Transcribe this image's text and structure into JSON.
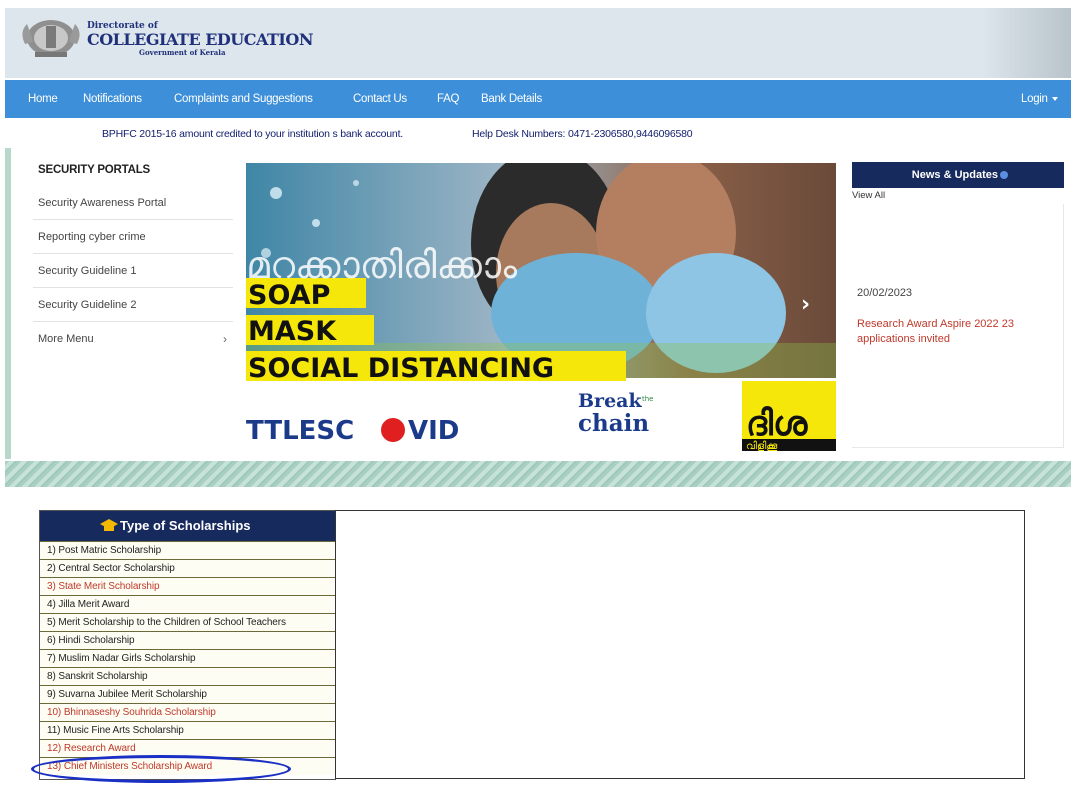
{
  "header": {
    "line1": "Directorate of",
    "line2": "COLLEGIATE EDUCATION",
    "line3": "Government of Kerala"
  },
  "nav": {
    "items": [
      "Home",
      "Notifications",
      "Complaints and Suggestions",
      "Contact Us",
      "FAQ",
      "Bank Details"
    ],
    "login": "Login"
  },
  "ticker": {
    "text1": "BPHFC 2015-16 amount credited to your institution s bank account.",
    "text2": "Help Desk Numbers: 0471-2306580,9446096580"
  },
  "security": {
    "title": "SECURITY PORTALS",
    "items": [
      "Security Awareness Portal",
      "Reporting cyber crime",
      "Security Guideline 1",
      "Security Guideline 2",
      "More Menu"
    ]
  },
  "banner": {
    "malayalam": "മറക്കാതിരിക്കാം",
    "words": [
      "SOAP",
      "MASK",
      "SOCIAL DISTANCING"
    ],
    "covid_left": "TTLESC",
    "covid_right": "VID",
    "break": "Break",
    "the": "the",
    "chain": "chain",
    "disha": "ദിശ",
    "disha_sub": "വിളിക്കൂ",
    "next_icon": "chevron-right-icon"
  },
  "news": {
    "title": "News & Updates",
    "view_all": "View All",
    "date": "20/02/2023",
    "text": "Research Award Aspire 2022 23 applications invited"
  },
  "scholarships": {
    "title": "Type of Scholarships",
    "items": [
      {
        "label": "1) Post Matric Scholarship",
        "highlight": false
      },
      {
        "label": "2) Central Sector Scholarship",
        "highlight": false
      },
      {
        "label": "3) State Merit Scholarship",
        "highlight": true
      },
      {
        "label": "4) Jilla Merit Award",
        "highlight": false
      },
      {
        "label": "5) Merit Scholarship to the Children of School Teachers",
        "highlight": false
      },
      {
        "label": "6) Hindi Scholarship",
        "highlight": false
      },
      {
        "label": "7) Muslim Nadar Girls Scholarship",
        "highlight": false
      },
      {
        "label": "8) Sanskrit Scholarship",
        "highlight": false
      },
      {
        "label": "9) Suvarna Jubilee Merit Scholarship",
        "highlight": false
      },
      {
        "label": "10) Bhinnaseshy Souhrida Scholarship",
        "highlight": true
      },
      {
        "label": "11) Music Fine Arts Scholarship",
        "highlight": false
      },
      {
        "label": "12) Research Award",
        "highlight": true
      },
      {
        "label": "13) Chief Ministers Scholarship Award",
        "highlight": true
      }
    ]
  },
  "colors": {
    "nav": "#3d8fd9",
    "dark_navy": "#172a5e",
    "highlight": "#c0392b",
    "banner_yellow": "#f5e70a",
    "annotation": "#1a2fc4"
  }
}
